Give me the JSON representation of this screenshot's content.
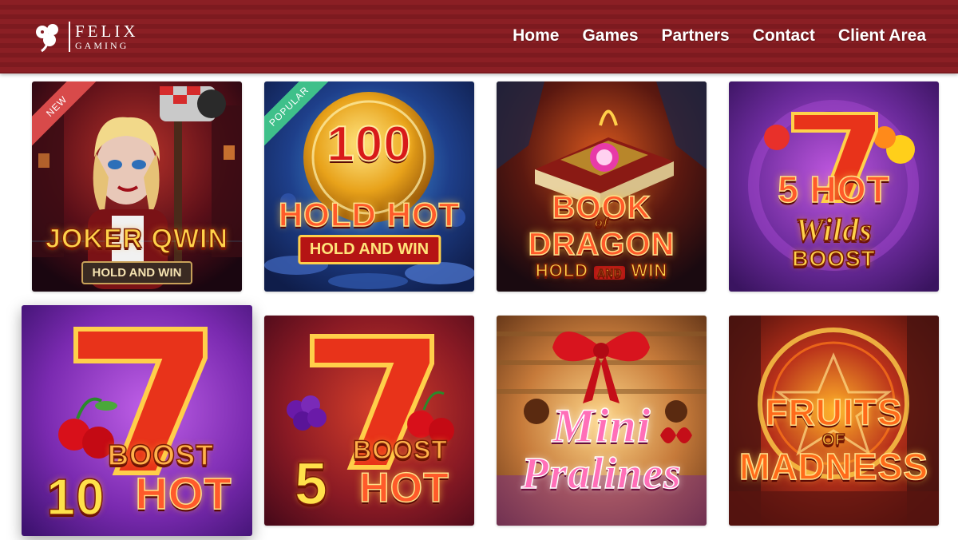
{
  "brand": {
    "name_line1": "FELIX",
    "name_line2": "GAMING",
    "icon": "clover-leaf-icon"
  },
  "nav": {
    "items": [
      {
        "label": "Home"
      },
      {
        "label": "Games"
      },
      {
        "label": "Partners"
      },
      {
        "label": "Contact"
      },
      {
        "label": "Client Area"
      }
    ]
  },
  "games": [
    {
      "title": "JOKER QWIN",
      "subtitle": "HOLD AND WIN",
      "badge": "NEW",
      "badge_color": "#d84a4a"
    },
    {
      "title_number": "100",
      "title": "HOLD HOT",
      "subtitle": "HOLD AND WIN",
      "badge": "POPULAR",
      "badge_color": "#3fc08a"
    },
    {
      "title_top": "BOOK",
      "title_of": "of",
      "title": "DRAGON",
      "subtitle_a": "HOLD",
      "subtitle_and": "AND",
      "subtitle_b": "WIN"
    },
    {
      "title_number": "5",
      "title": "HOT",
      "title_script": "Wilds",
      "subtitle": "BOOST"
    },
    {
      "title_number": "10",
      "title_top": "BOOST",
      "title": "HOT",
      "hovered": true
    },
    {
      "title_number": "5",
      "title_top": "BOOST",
      "title": "HOT"
    },
    {
      "title_top": "Mini",
      "title": "Pralines"
    },
    {
      "title_top": "FRUITS",
      "title_of": "OF",
      "title": "MADNESS"
    }
  ],
  "colors": {
    "header_bg": "#861d22",
    "nav_text": "#ffffff",
    "new_badge": "#d84a4a",
    "popular_badge": "#3fc08a"
  }
}
